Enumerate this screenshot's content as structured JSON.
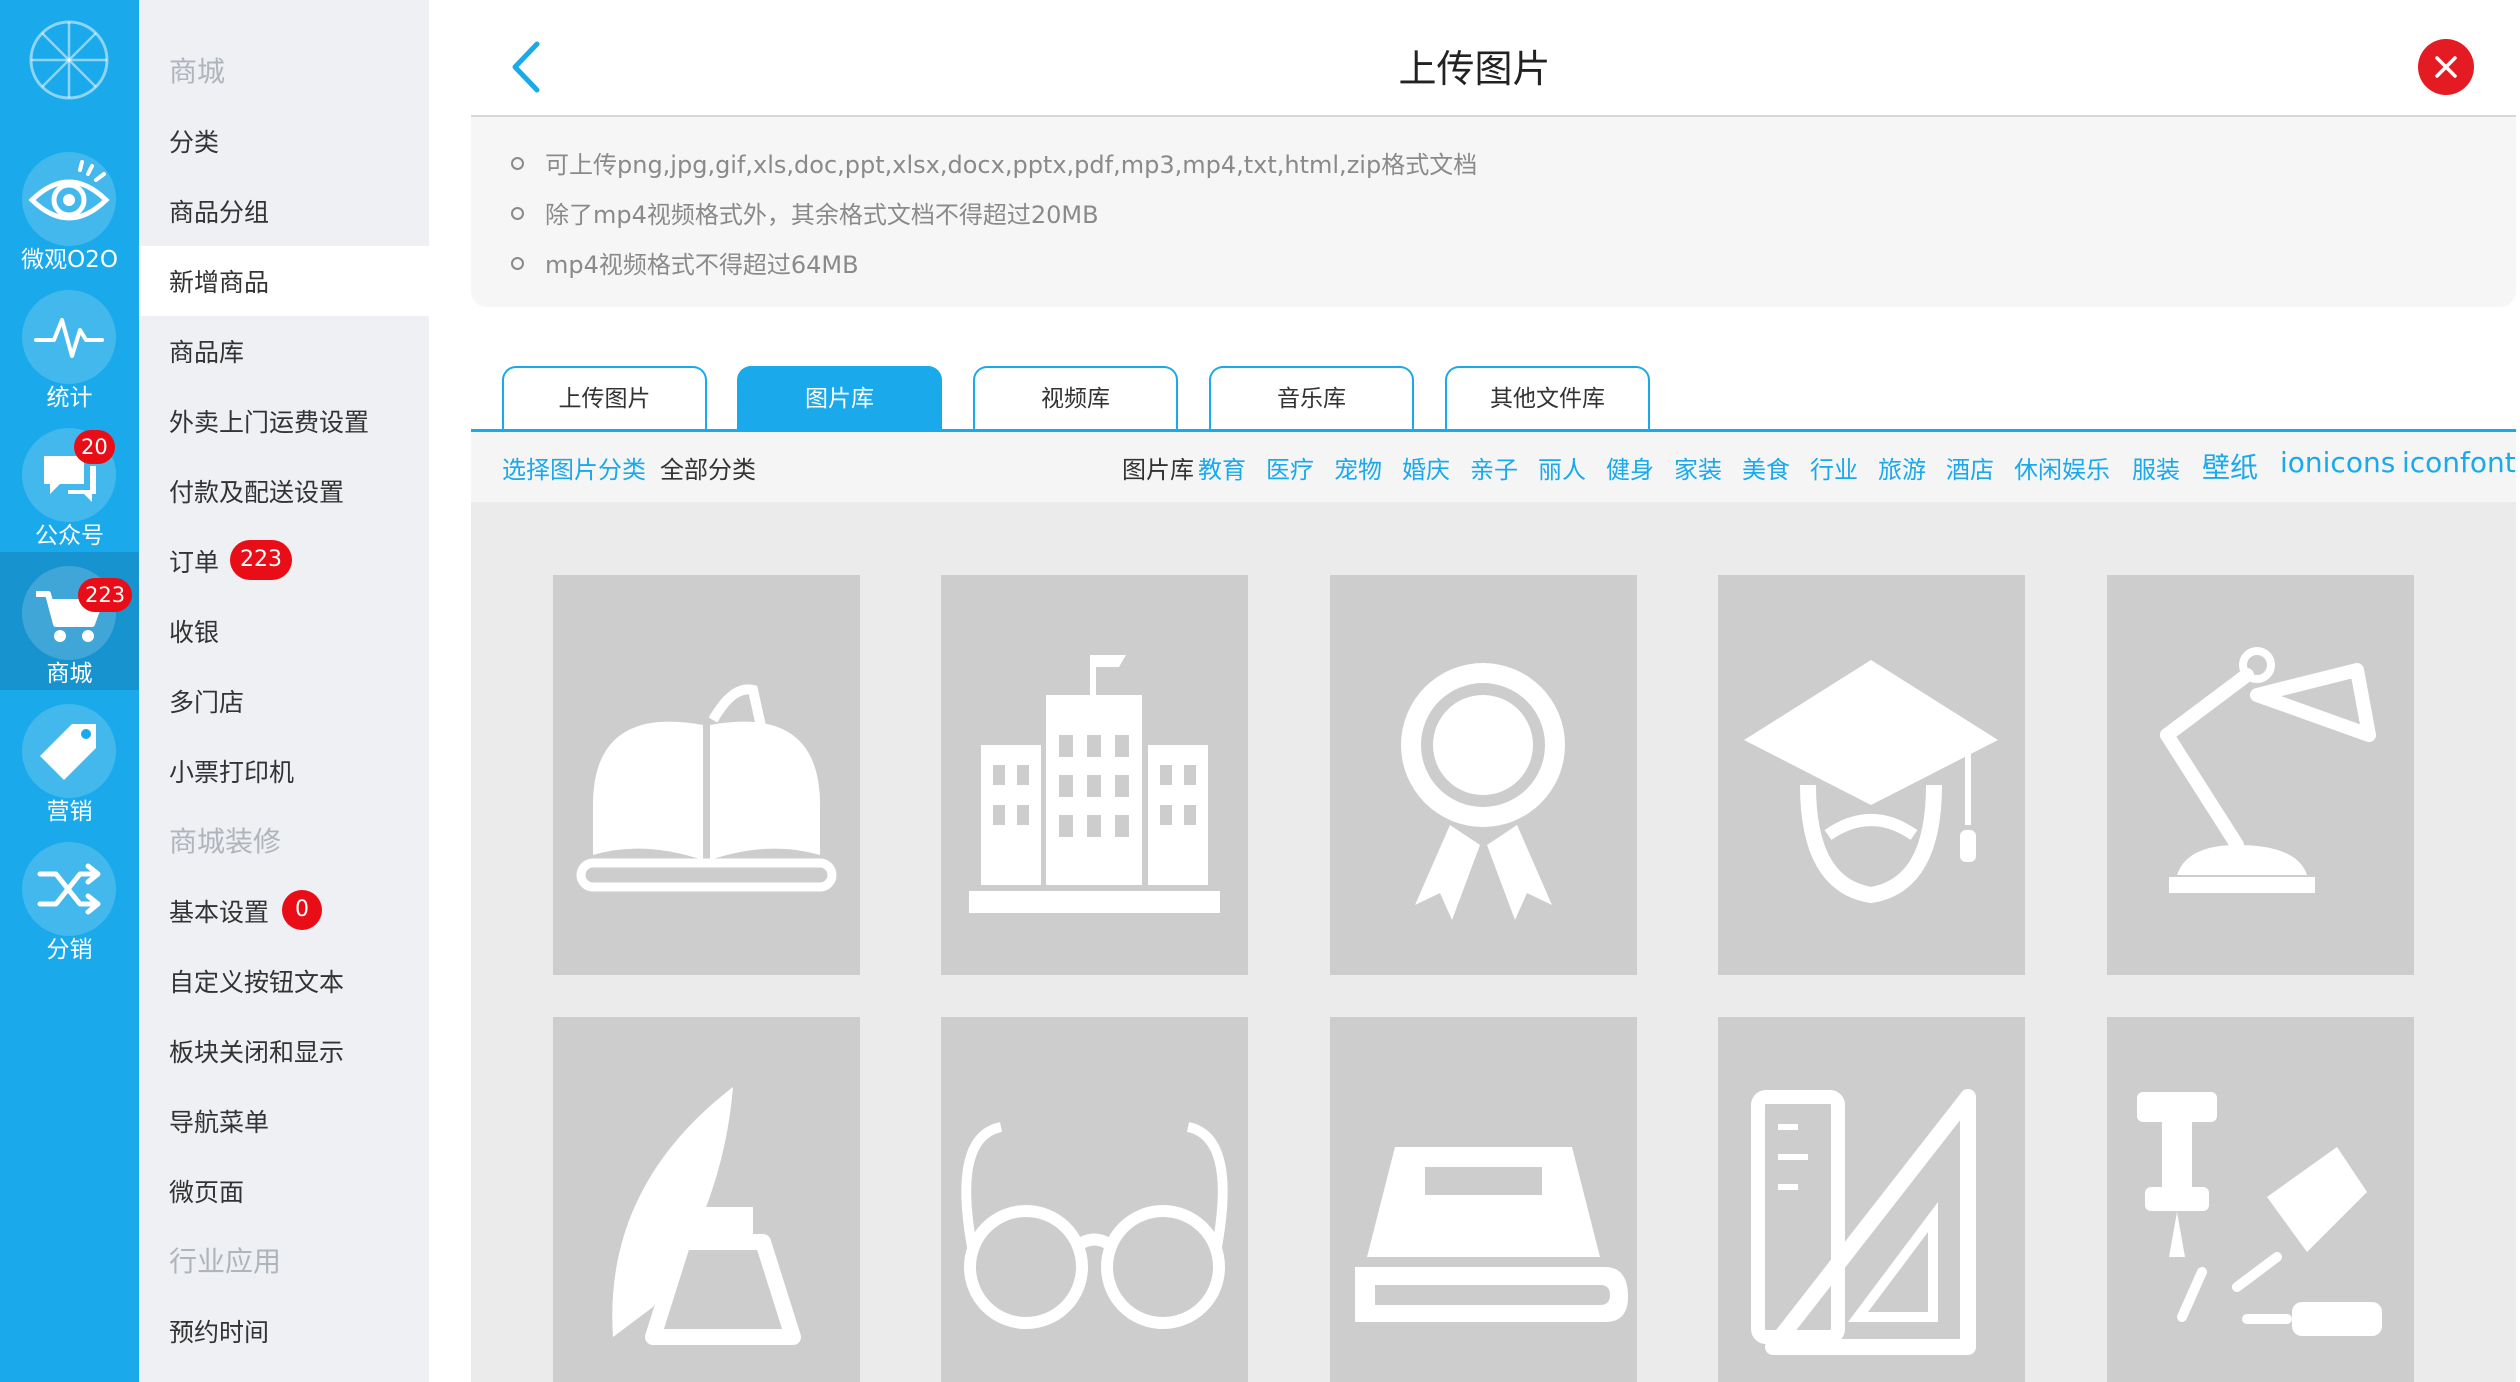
{
  "rail": {
    "items": [
      {
        "label": "微观O2O",
        "icon": "eye-icon",
        "badge": ""
      },
      {
        "label": "统计",
        "icon": "pulse-icon",
        "badge": ""
      },
      {
        "label": "公众号",
        "icon": "chat-icon",
        "badge": "20"
      },
      {
        "label": "商城",
        "icon": "cart-icon",
        "badge": "223"
      },
      {
        "label": "营销",
        "icon": "tag-icon",
        "badge": ""
      },
      {
        "label": "分销",
        "icon": "shuffle-icon",
        "badge": ""
      }
    ]
  },
  "menu": {
    "items": [
      {
        "label": "商城",
        "badge": ""
      },
      {
        "label": "分类",
        "badge": ""
      },
      {
        "label": "商品分组",
        "badge": ""
      },
      {
        "label": "新增商品",
        "badge": ""
      },
      {
        "label": "商品库",
        "badge": ""
      },
      {
        "label": "外卖上门运费设置",
        "badge": ""
      },
      {
        "label": "付款及配送设置",
        "badge": ""
      },
      {
        "label": "订单",
        "badge": "223"
      },
      {
        "label": "收银",
        "badge": ""
      },
      {
        "label": "多门店",
        "badge": ""
      },
      {
        "label": "小票打印机",
        "badge": ""
      },
      {
        "label": "商城装修",
        "badge": ""
      },
      {
        "label": "基本设置",
        "badge": "0"
      },
      {
        "label": "自定义按钮文本",
        "badge": ""
      },
      {
        "label": "板块关闭和显示",
        "badge": ""
      },
      {
        "label": "导航菜单",
        "badge": ""
      },
      {
        "label": "微页面",
        "badge": ""
      },
      {
        "label": "行业应用",
        "badge": ""
      },
      {
        "label": "预约时间",
        "badge": ""
      }
    ]
  },
  "header": {
    "title": "上传图片"
  },
  "notes": [
    "可上传png,jpg,gif,xls,doc,ppt,xlsx,docx,pptx,pdf,mp3,mp4,txt,html,zip格式文档",
    "除了mp4视频格式外，其余格式文档不得超过20MB",
    "mp4视频格式不得超过64MB"
  ],
  "tabs": [
    "上传图片",
    "图片库",
    "视频库",
    "音乐库",
    "其他文件库"
  ],
  "filters": {
    "select_label": "选择图片分类",
    "all_label": "全部分类",
    "library_label": "图片库",
    "categories": [
      "教育",
      "医疗",
      "宠物",
      "婚庆",
      "亲子",
      "丽人",
      "健身",
      "家装",
      "美食",
      "行业",
      "旅游",
      "酒店",
      "休闲娱乐",
      "服装",
      "壁纸",
      "ionicons",
      "iconfont"
    ]
  },
  "gallery": {
    "icons": [
      "open-book-icon",
      "school-building-icon",
      "award-ribbon-icon",
      "graduate-cap-icon",
      "desk-lamp-icon",
      "quill-inkwell-icon",
      "glasses-icon",
      "stacked-books-icon",
      "ruler-triangle-icon",
      "pushpins-icon"
    ]
  },
  "colors": {
    "accent": "#1aa9ea",
    "badge": "#e80d16",
    "close": "#e51b23"
  }
}
